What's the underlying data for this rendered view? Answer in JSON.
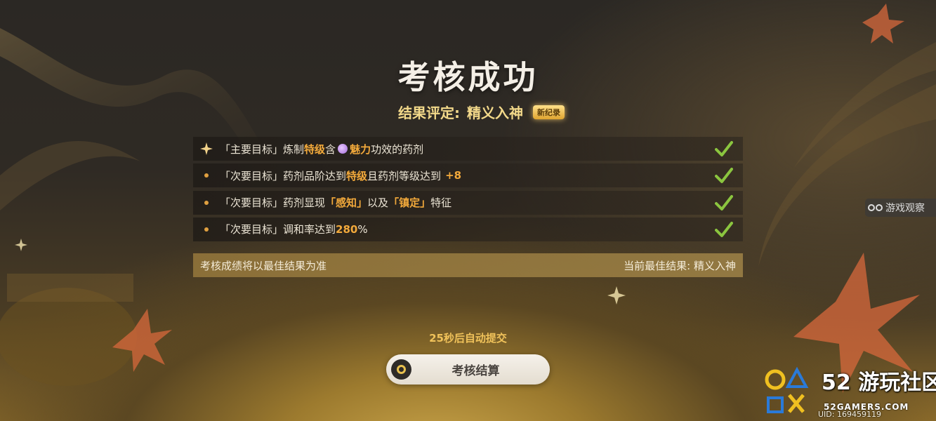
{
  "title": "考核成功",
  "rating": {
    "label": "结果评定:",
    "value": "精义入神",
    "badge": "新纪录"
  },
  "objectives": [
    {
      "tag": "「主要目标」",
      "segments": [
        "炼制",
        "特级",
        "含",
        "魅力",
        "功效的药剂"
      ]
    },
    {
      "tag": "「次要目标」",
      "segments": [
        "药剂品阶达到",
        "特级",
        "且药剂等级达到",
        "+8"
      ]
    },
    {
      "tag": "「次要目标」",
      "segments": [
        "药剂显现",
        "「感知」",
        "以及",
        "「镇定」",
        "特征"
      ]
    },
    {
      "tag": "「次要目标」",
      "segments": [
        "调和率达到",
        "280",
        "%"
      ]
    }
  ],
  "result_bar": {
    "note": "考核成绩将以最佳结果为准",
    "best": "当前最佳结果: 精义入神"
  },
  "countdown": "25秒后自动提交",
  "submit_button": "考核结算",
  "watch_tag": "游戏观察",
  "watermark": {
    "number": "52",
    "name": "游玩社区",
    "domain": "52GAMERS.COM"
  },
  "uid": "UID: 169459119",
  "colors": {
    "highlight": "#f2a93b",
    "rating": "#f3d98a",
    "check": "#8bc53f"
  }
}
